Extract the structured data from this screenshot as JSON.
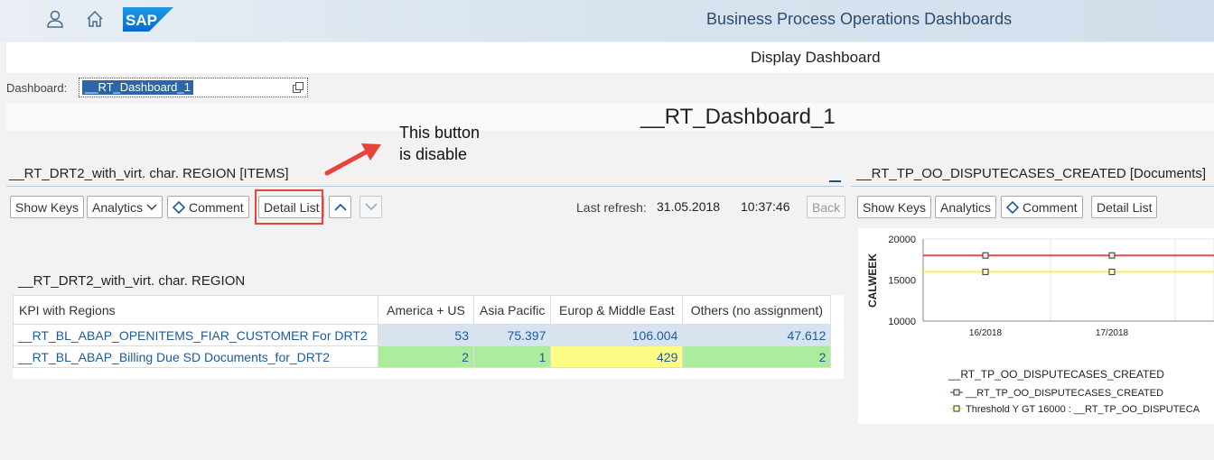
{
  "shell": {
    "title": "Business Process Operations Dashboards",
    "logo_text": "SAP",
    "icons": [
      "user-icon",
      "home-icon"
    ]
  },
  "page": {
    "title": "Display Dashboard"
  },
  "dashboard": {
    "label": "Dashboard:",
    "value": "__RT_Dashboard_1",
    "heading": "__RT_Dashboard_1"
  },
  "annotation": {
    "line1": "This button",
    "line2": "is disable",
    "color": "#e8423b"
  },
  "left_panel": {
    "title": "__RT_DRT2_with_virt. char. REGION [ITEMS]",
    "buttons": {
      "show_keys": "Show Keys",
      "analytics": "Analytics",
      "comment": "Comment",
      "detail_list": "Detail List",
      "back": "Back"
    },
    "last_refresh_label": "Last refresh:",
    "last_refresh_date": "31.05.2018",
    "last_refresh_time": "10:37:46",
    "table": {
      "title": "__RT_DRT2_with_virt. char. REGION",
      "headers": [
        "KPI with Regions",
        "America + US",
        "Asia Pacific",
        "Europ & Middle East",
        "Others (no assignment)"
      ],
      "rows": [
        {
          "kpi": "__RT_BL_ABAP_OPENITEMS_FIAR_CUSTOMER For DRT2",
          "values": [
            "53",
            "75.397",
            "106.004",
            "47.612"
          ],
          "colors": [
            "blue",
            "blue",
            "blue",
            "blue"
          ]
        },
        {
          "kpi": "__RT_BL_ABAP_Billing Due SD Documents_for_DRT2",
          "values": [
            "2",
            "1",
            "429",
            "2"
          ],
          "colors": [
            "green",
            "green",
            "yellow",
            "green"
          ]
        }
      ]
    }
  },
  "right_panel": {
    "title": "__RT_TP_OO_DISPUTECASES_CREATED [Documents]",
    "buttons": {
      "show_keys": "Show Keys",
      "analytics": "Analytics",
      "comment": "Comment",
      "detail_list": "Detail List"
    }
  },
  "chart_data": {
    "type": "line",
    "ylabel": "CALWEEK",
    "y_ticks": [
      "20000",
      "15000",
      "10000"
    ],
    "categories": [
      "16/2018",
      "17/2018"
    ],
    "ylim": [
      10000,
      20000
    ],
    "series": [
      {
        "name": "__RT_TP_OO_DISPUTECASES_CREATED",
        "values": [
          18000,
          18000
        ],
        "color": "#e84a4a"
      },
      {
        "name": "Threshold Y GT 16000 : __RT_TP_OO_DISPUTECA",
        "values": [
          16000,
          16000
        ],
        "color": "#f4f05a"
      }
    ],
    "legend_title": "__RT_TP_OO_DISPUTECASES_CREATED",
    "grid": true
  }
}
